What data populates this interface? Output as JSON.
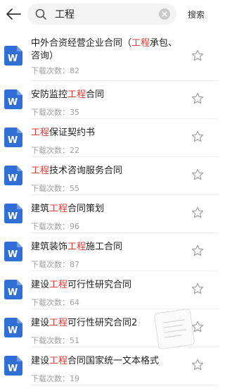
{
  "search": {
    "query": "工程",
    "button_label": "搜索"
  },
  "items": [
    {
      "pre": "中外合资经营企业合同（",
      "hl": "工程",
      "post": "承包、",
      "line2": "咨询）",
      "downloads": "下载次数：82"
    },
    {
      "pre": "安防监控",
      "hl": "工程",
      "post": "合同",
      "downloads": "下载次数：35"
    },
    {
      "pre": "",
      "hl": "工程",
      "post": "保证契约书",
      "downloads": "下载次数：22"
    },
    {
      "pre": "",
      "hl": "工程",
      "post": "技术咨询服务合同",
      "downloads": "下载次数：55"
    },
    {
      "pre": "建筑",
      "hl": "工程",
      "post": "合同策划",
      "downloads": "下载次数：96"
    },
    {
      "pre": "建筑装饰",
      "hl": "工程",
      "post": "施工合同",
      "downloads": "下载次数：87"
    },
    {
      "pre": "建设",
      "hl": "工程",
      "post": "可行性研究合同",
      "downloads": "下载次数：64"
    },
    {
      "pre": "建设",
      "hl": "工程",
      "post": "可行性研究合同2",
      "downloads": "下载次数：51"
    },
    {
      "pre": "建设",
      "hl": "工程",
      "post": "合同国家统一文本格式",
      "downloads": "下载次数：19"
    }
  ],
  "icons": {
    "doc": "word-document-icon",
    "doc_letter": "W",
    "doc_color": "#2f6fd6",
    "star": "star-outline-icon",
    "highlight_color": "#e53935"
  }
}
